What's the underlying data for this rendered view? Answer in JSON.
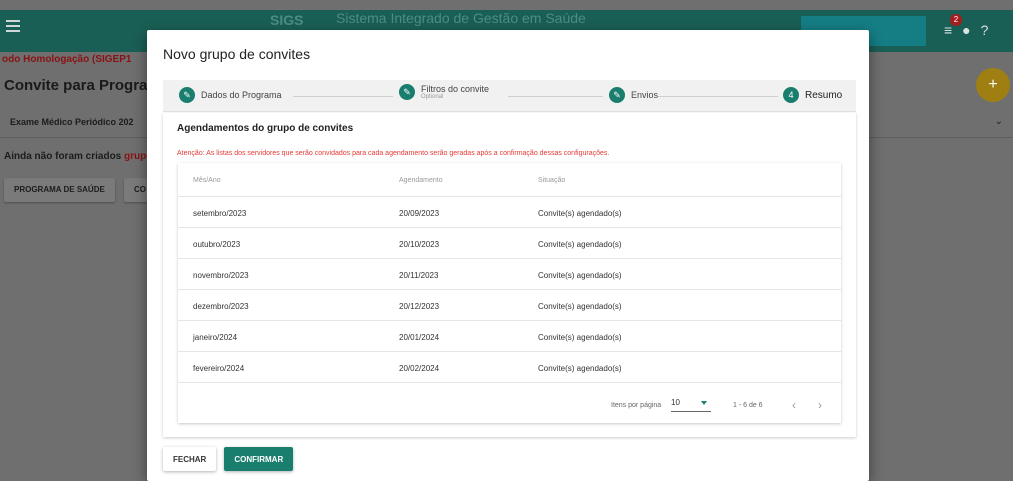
{
  "topbar": {
    "logo": "SIGS",
    "title": "Sistema Integrado de Gestão em Saúde",
    "notification_count": "2"
  },
  "background": {
    "env_label": "odo Homologação (SIGEP1",
    "page_title": "Convite para Prograr",
    "exam_label": "Exame Médico Periódico 202",
    "notice_prefix": "Ainda não foram criados",
    "notice_highlight": "grupo",
    "btn_program": "PROGRAMA DE SAÚDE",
    "btn_other": "CO",
    "fab": "+"
  },
  "modal": {
    "title": "Novo grupo de convites",
    "steps": [
      {
        "label": "Dados do Programa",
        "sub": ""
      },
      {
        "label": "Filtros do convite",
        "sub": "Optional"
      },
      {
        "label": "Envios",
        "sub": ""
      },
      {
        "label": "Resumo",
        "sub": "",
        "number": "4"
      }
    ],
    "panel_title": "Agendamentos do grupo de convites",
    "warning": "Atenção: As listas dos servidores que serão convidados para cada agendamento serão geradas após a confirmação dessas configurações.",
    "table": {
      "headers": [
        "Mês/Ano",
        "Agendamento",
        "Situação"
      ],
      "rows": [
        [
          "setembro/2023",
          "20/09/2023",
          "Convite(s) agendado(s)"
        ],
        [
          "outubro/2023",
          "20/10/2023",
          "Convite(s) agendado(s)"
        ],
        [
          "novembro/2023",
          "20/11/2023",
          "Convite(s) agendado(s)"
        ],
        [
          "dezembro/2023",
          "20/12/2023",
          "Convite(s) agendado(s)"
        ],
        [
          "janeiro/2024",
          "20/01/2024",
          "Convite(s) agendado(s)"
        ],
        [
          "fevereiro/2024",
          "20/02/2024",
          "Convite(s) agendado(s)"
        ]
      ]
    },
    "paginator": {
      "label": "Itens por página",
      "page_size": "10",
      "range": "1 - 6 de 6"
    },
    "btn_close": "FECHAR",
    "btn_confirm": "CONFIRMAR"
  }
}
